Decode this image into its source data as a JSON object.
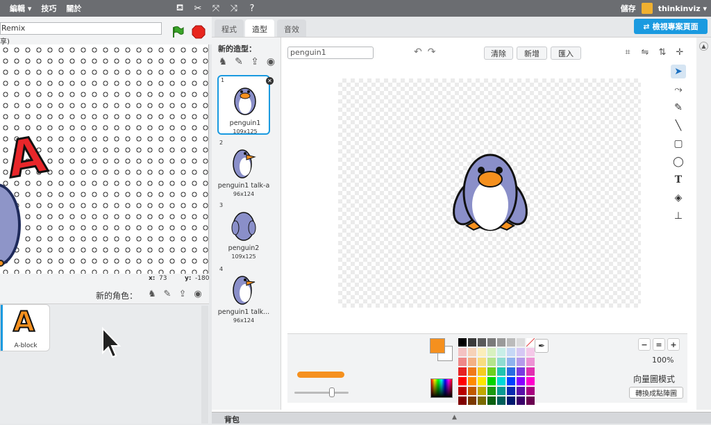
{
  "menu": {
    "edit": "編輯 ▾",
    "tips": "技巧",
    "about": "關於",
    "save": "儲存",
    "user": "thinkinviz ▾"
  },
  "project": {
    "title": "Remix",
    "subtitle": "享)"
  },
  "stage": {
    "letter": "A",
    "coords_x_label": "x:",
    "coords_x": "73",
    "coords_y_label": "y:",
    "coords_y": "-180"
  },
  "sprites": {
    "new_label": "新的角色：",
    "items": [
      {
        "name": "A-block",
        "glyph": "A"
      }
    ]
  },
  "tabs": {
    "code": "程式",
    "costumes": "造型",
    "sounds": "音效"
  },
  "view_project": "檢視專案頁面",
  "costumes": {
    "new_label": "新的造型：",
    "items": [
      {
        "index": "1",
        "name": "penguin1",
        "size": "109x125"
      },
      {
        "index": "2",
        "name": "penguin1 talk-a",
        "size": "96x124"
      },
      {
        "index": "3",
        "name": "penguin2",
        "size": "109x125"
      },
      {
        "index": "4",
        "name": "penguin1 talk...",
        "size": "96x124"
      }
    ]
  },
  "editor": {
    "costume_name": "penguin1",
    "clear": "清除",
    "add": "新增",
    "import": "匯入",
    "zoom": "100%",
    "mode": "向量圖模式",
    "convert": "轉換成點陣圖"
  },
  "colors": {
    "accent": "#1a9ae0",
    "primary_fill": "#f5901e"
  },
  "palette": [
    "#000000",
    "#3a3a3a",
    "#5a5a5a",
    "#7a7a7a",
    "#9a9a9a",
    "#bbbbbb",
    "#dcdcdc",
    "#ffffff",
    "#f4c2c2",
    "#f6d2b8",
    "#fbeebb",
    "#d8f1c0",
    "#c8eee8",
    "#c6d8f6",
    "#d6c8f4",
    "#f4c8e8",
    "#ee8888",
    "#f3b184",
    "#f7dd80",
    "#b4e48c",
    "#8fdcd2",
    "#8fb2ee",
    "#b69aea",
    "#ec92d4",
    "#e62222",
    "#f07a1a",
    "#f4cc20",
    "#6cd020",
    "#20c4b0",
    "#2a6ce2",
    "#7a3ae0",
    "#e030b0",
    "#ff0000",
    "#ff8c00",
    "#ffe600",
    "#00d400",
    "#00d8d8",
    "#0040ff",
    "#8800ff",
    "#ff00cc",
    "#b80000",
    "#c05a00",
    "#c0a800",
    "#1a9a10",
    "#0a9a94",
    "#0a2ab0",
    "#5a10a8",
    "#a80080",
    "#800000",
    "#7a3800",
    "#7a6a00",
    "#0a6010",
    "#005e5a",
    "#00186e",
    "#3a0068",
    "#6a0050"
  ]
}
